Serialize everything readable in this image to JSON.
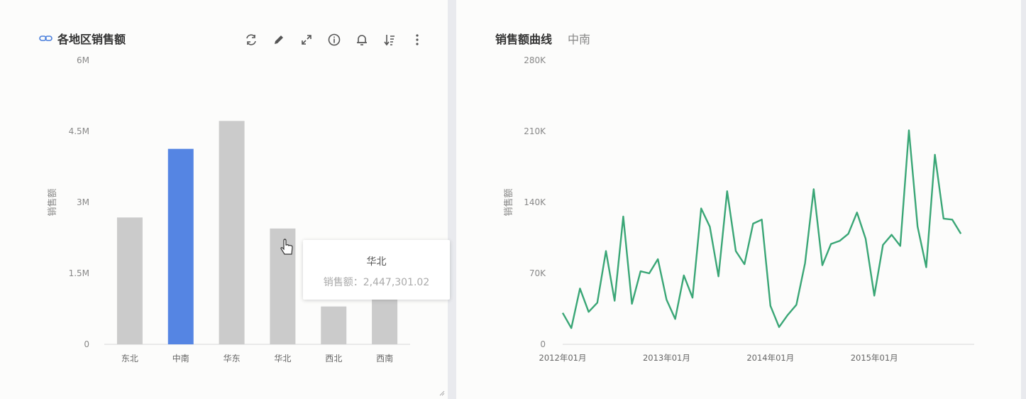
{
  "left_panel": {
    "title": "各地区销售额",
    "toolbar": [
      {
        "name": "refresh-icon"
      },
      {
        "name": "edit-icon"
      },
      {
        "name": "expand-icon"
      },
      {
        "name": "info-icon"
      },
      {
        "name": "bell-icon"
      },
      {
        "name": "sort-icon"
      },
      {
        "name": "more-icon"
      }
    ],
    "tooltip": {
      "category": "华北",
      "label": "销售额：2,447,301.02"
    }
  },
  "right_panel": {
    "title": "销售额曲线",
    "subtitle": "中南"
  },
  "colors": {
    "bar_default": "#cbcbcb",
    "bar_highlight": "#5585e3",
    "line": "#3aa676",
    "axis_text": "#888888"
  },
  "chart_data": [
    {
      "type": "bar",
      "title": "各地区销售额",
      "ylabel": "销售额",
      "categories": [
        "东北",
        "中南",
        "华东",
        "华北",
        "西北",
        "西南"
      ],
      "values": [
        2680000,
        4130000,
        4720000,
        2447301.02,
        800000,
        1050000
      ],
      "highlighted_category": "中南",
      "ylim": [
        0,
        6000000
      ],
      "yticks": [
        0,
        1500000,
        3000000,
        4500000,
        6000000
      ],
      "ytick_labels": [
        "0",
        "1.5M",
        "3M",
        "4.5M",
        "6M"
      ]
    },
    {
      "type": "line",
      "title": "销售额曲线",
      "subtitle": "中南",
      "ylabel": "销售额",
      "ylim": [
        0,
        280000
      ],
      "yticks": [
        0,
        70000,
        140000,
        210000,
        280000
      ],
      "ytick_labels": [
        "0",
        "70K",
        "140K",
        "210K",
        "280K"
      ],
      "xtick_labels": [
        "2012年01月",
        "2013年01月",
        "2014年01月",
        "2015年01月"
      ],
      "x_start": "2012年01月",
      "values": [
        31000,
        16000,
        55000,
        32000,
        41000,
        92000,
        43000,
        126000,
        40000,
        72000,
        70000,
        84000,
        44000,
        25000,
        68000,
        46000,
        134000,
        116000,
        67000,
        151000,
        92000,
        79000,
        119000,
        123000,
        38000,
        17000,
        29000,
        39000,
        80000,
        153000,
        78000,
        99000,
        102000,
        109000,
        130000,
        104000,
        48000,
        98000,
        108000,
        97000,
        211000,
        116000,
        76000,
        187000,
        124000,
        123000,
        109000
      ]
    }
  ]
}
